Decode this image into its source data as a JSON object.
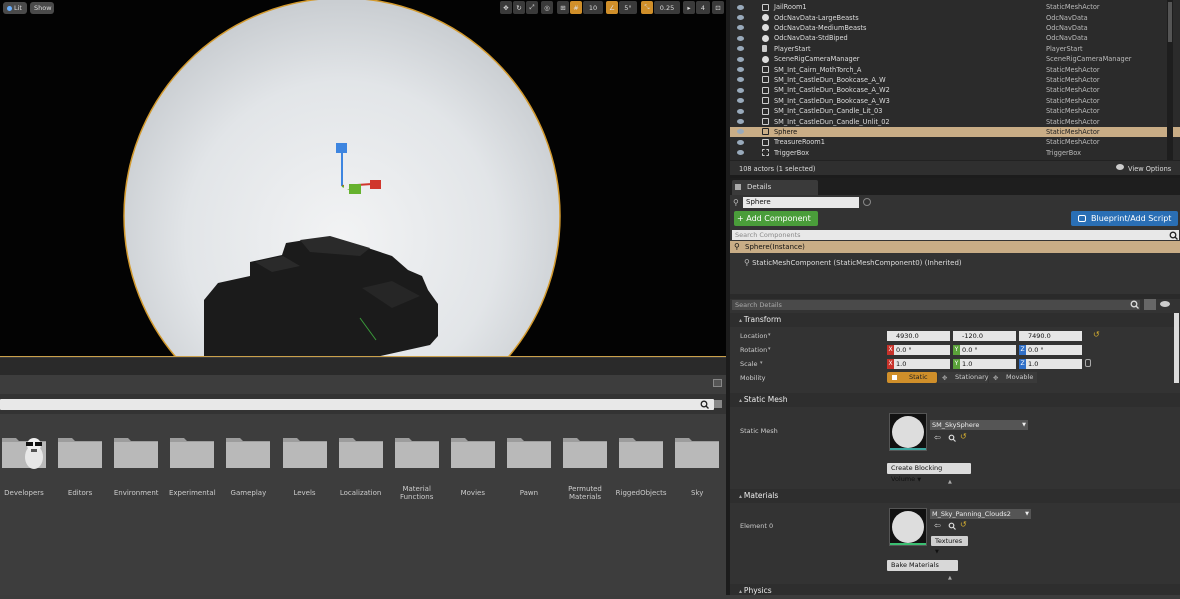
{
  "viewport": {
    "lit_label": "Lit",
    "show_label": "Show",
    "grid_snap": "10",
    "rot_snap": "5°",
    "scale_snap": "0.25",
    "cam_speed": "4"
  },
  "content_browser": {
    "folders": [
      {
        "label": "Developers"
      },
      {
        "label": "Editors"
      },
      {
        "label": "Environment"
      },
      {
        "label": "Experimental"
      },
      {
        "label": "Gameplay"
      },
      {
        "label": "Levels"
      },
      {
        "label": "Localization"
      },
      {
        "label": "Material Functions"
      },
      {
        "label": "Movies"
      },
      {
        "label": "Pawn"
      },
      {
        "label": "Permuted Materials"
      },
      {
        "label": "RiggedObjects"
      },
      {
        "label": "Sky"
      }
    ]
  },
  "outliner": {
    "rows": [
      {
        "name": "JailRoom1",
        "type": "StaticMeshActor",
        "icon": "mesh-icon"
      },
      {
        "name": "OdcNavData-LargeBeasts",
        "type": "OdcNavData",
        "icon": "sphere-icon"
      },
      {
        "name": "OdcNavData-MediumBeasts",
        "type": "OdcNavData",
        "icon": "sphere-icon"
      },
      {
        "name": "OdcNavData-StdBiped",
        "type": "OdcNavData",
        "icon": "sphere-icon"
      },
      {
        "name": "PlayerStart",
        "type": "PlayerStart",
        "icon": "flag-icon"
      },
      {
        "name": "SceneRigCameraManager",
        "type": "SceneRigCameraManager",
        "icon": "sphere-icon"
      },
      {
        "name": "SM_Int_Cairn_MothTorch_A",
        "type": "StaticMeshActor",
        "icon": "mesh-icon"
      },
      {
        "name": "SM_Int_CastleDun_Bookcase_A_W",
        "type": "StaticMeshActor",
        "icon": "mesh-icon"
      },
      {
        "name": "SM_Int_CastleDun_Bookcase_A_W2",
        "type": "StaticMeshActor",
        "icon": "mesh-icon"
      },
      {
        "name": "SM_Int_CastleDun_Bookcase_A_W3",
        "type": "StaticMeshActor",
        "icon": "mesh-icon"
      },
      {
        "name": "SM_Int_CastleDun_Candle_Lit_03",
        "type": "StaticMeshActor",
        "icon": "mesh-icon"
      },
      {
        "name": "SM_Int_CastleDun_Candle_Unlit_02",
        "type": "StaticMeshActor",
        "icon": "mesh-icon"
      },
      {
        "name": "Sphere",
        "type": "StaticMeshActor",
        "icon": "mesh-icon",
        "selected": true
      },
      {
        "name": "TreasureRoom1",
        "type": "StaticMeshActor",
        "icon": "mesh-icon"
      },
      {
        "name": "TriggerBox",
        "type": "TriggerBox",
        "icon": "box-icon"
      }
    ],
    "status": "108 actors (1 selected)",
    "view_options": "View Options"
  },
  "details": {
    "tab": "Details",
    "name_value": "Sphere",
    "add_component": "+ Add Component",
    "blueprint": "Blueprint/Add Script",
    "search_components_placeholder": "Search Components",
    "instance": "Sphere(Instance)",
    "component": "StaticMeshComponent (StaticMeshComponent0) (Inherited)",
    "search_details_placeholder": "Search Details",
    "transform": {
      "title": "Transform",
      "location_label": "Location",
      "rotation_label": "Rotation",
      "scale_label": "Scale",
      "mobility_label": "Mobility",
      "location": {
        "x": "4930.0",
        "y": "-120.0",
        "z": "7490.0"
      },
      "rotation": {
        "x": "0.0 °",
        "y": "0.0 °",
        "z": "0.0 °"
      },
      "scale": {
        "x": "1.0",
        "y": "1.0",
        "z": "1.0"
      },
      "mobility": {
        "static": "Static",
        "stationary": "Stationary",
        "movable": "Movable"
      }
    },
    "static_mesh": {
      "title": "Static Mesh",
      "label": "Static Mesh",
      "value": "SM_SkySphere",
      "blocking_volume": "Create Blocking Volume"
    },
    "materials": {
      "title": "Materials",
      "element_label": "Element 0",
      "value": "M_Sky_Panning_Clouds2",
      "textures": "Textures",
      "bake": "Bake Materials"
    },
    "physics": {
      "title": "Physics"
    }
  },
  "colors": {
    "accent_orange": "#d08f2a",
    "selection": "#c9ad86",
    "add_component_green": "#4a9d3a",
    "blueprint_blue": "#2a6fb5",
    "axis_x": "#c8322a",
    "axis_y": "#5ba23a",
    "axis_z": "#2f6fc8"
  }
}
